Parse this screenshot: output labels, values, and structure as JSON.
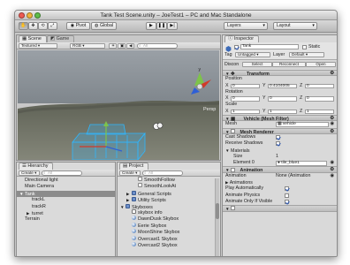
{
  "window": {
    "title": "Tank Test Scene.unity – JoeTest1 – PC and Mac Standalone"
  },
  "toolbar": {
    "transform_tools": [
      "✥",
      "✚",
      "⟲",
      "⤢"
    ],
    "pivot_label": "Pivot",
    "global_label": "Global",
    "play_controls": [
      "▶",
      "❚❚",
      "▶|"
    ],
    "layers_label": "Layers",
    "layout_label": "Layout"
  },
  "scene": {
    "tab_scene": "Scene",
    "tab_game": "Game",
    "shading": "Textured",
    "render_mode": "RGB",
    "search": "All",
    "persp": "Persp",
    "axis_y": "y"
  },
  "hierarchy": {
    "tab": "Hierarchy",
    "create": "Create",
    "search": "All",
    "items": [
      {
        "label": "Directional light",
        "indent": 0,
        "selected": false,
        "arrow": ""
      },
      {
        "label": "Main Camera",
        "indent": 0,
        "selected": false,
        "arrow": ""
      },
      {
        "label": "Tank",
        "indent": 0,
        "selected": true,
        "arrow": "▼"
      },
      {
        "label": "trackL",
        "indent": 1,
        "selected": false,
        "arrow": ""
      },
      {
        "label": "trackR",
        "indent": 1,
        "selected": false,
        "arrow": ""
      },
      {
        "label": "turret",
        "indent": 1,
        "selected": false,
        "arrow": "▶"
      },
      {
        "label": "Terrain",
        "indent": 0,
        "selected": false,
        "arrow": ""
      }
    ]
  },
  "project": {
    "tab": "Project",
    "create": "Create",
    "search": "All",
    "items": [
      {
        "label": "SmoothFollow",
        "indent": 2,
        "icon": "script",
        "arrow": ""
      },
      {
        "label": "SmoothLookAt",
        "indent": 2,
        "icon": "script",
        "arrow": ""
      },
      {
        "label": "General Scripts",
        "indent": 1,
        "icon": "folder",
        "arrow": "▶"
      },
      {
        "label": "Utility Scripts",
        "indent": 1,
        "icon": "folder",
        "arrow": "▶"
      },
      {
        "label": "Skyboxes",
        "indent": 0,
        "icon": "folder",
        "arrow": "▼"
      },
      {
        "label": "skybox info",
        "indent": 1,
        "icon": "doc",
        "arrow": ""
      },
      {
        "label": "DawnDusk Skybox",
        "indent": 1,
        "icon": "sphere",
        "arrow": ""
      },
      {
        "label": "Eerie Skybox",
        "indent": 1,
        "icon": "sphere",
        "arrow": ""
      },
      {
        "label": "MoonShine Skybox",
        "indent": 1,
        "icon": "sphere",
        "arrow": ""
      },
      {
        "label": "Overcast1 Skybox",
        "indent": 1,
        "icon": "sphere",
        "arrow": ""
      },
      {
        "label": "Overcast2 Skybox",
        "indent": 1,
        "icon": "sphere",
        "arrow": ""
      }
    ]
  },
  "inspector": {
    "tab": "Inspector",
    "object_name": "Tank",
    "static_label": "Static",
    "tag_label": "Tag",
    "tag_value": "Untagged",
    "layer_label": "Layer",
    "layer_value": "Default",
    "prefab_label": "Discon",
    "prefab_buttons": [
      "Select",
      "Reconnect",
      "Open"
    ],
    "transform": {
      "title": "Transform",
      "position_label": "Position",
      "position": [
        "0",
        "0.4104005",
        "0"
      ],
      "rotation_label": "Rotation",
      "rotation": [
        "0",
        "0",
        "0"
      ],
      "scale_label": "Scale",
      "scale": [
        "1",
        "1",
        "1"
      ]
    },
    "mesh_filter": {
      "title": "Vehicle (Mesh Filter)",
      "mesh_label": "Mesh",
      "mesh_value": "vehicle"
    },
    "mesh_renderer": {
      "title": "Mesh Renderer",
      "cast_shadows": "Cast Shadows",
      "receive_shadows": "Receive Shadows",
      "materials": "Materials",
      "size_label": "Size",
      "size_value": "1",
      "element_label": "Element 0",
      "element_value": "tile_blue1"
    },
    "animation": {
      "title": "Animation",
      "animation_label": "Animation",
      "animation_value": "None (Animation",
      "animations": "Animations",
      "play_auto": "Play Automatically",
      "animate_physics": "Animate Physics",
      "animate_visible": "Animate Only If Visible"
    }
  },
  "colors": {
    "selection": "#8c8c8c",
    "scene_sky": "#8d9399",
    "ground": "#6f7266",
    "gizmo_y": "#7ec34a",
    "gizmo_x": "#d23a2a"
  }
}
